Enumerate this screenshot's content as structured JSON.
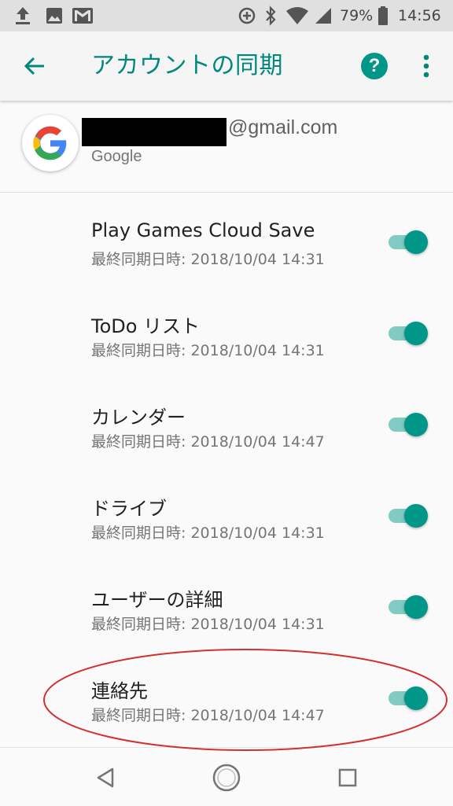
{
  "status_bar": {
    "icons": [
      "upload-icon",
      "image-icon",
      "gmail-icon",
      "data-saver-icon",
      "bluetooth-icon",
      "wifi-icon",
      "signal-icon",
      "battery-icon"
    ],
    "battery": "79%",
    "time": "14:56"
  },
  "app_bar": {
    "title": "アカウントの同期",
    "back_icon": "arrow-back-icon",
    "help_label": "?",
    "more_icon": "more-vert-icon",
    "accent_color": "#00897b"
  },
  "account": {
    "email_suffix": "@gmail.com",
    "provider": "Google",
    "avatar_icon": "google-g-icon"
  },
  "sync_items": [
    {
      "title": "Play Games Cloud Save",
      "subtitle": "最終同期日時: 2018/10/04 14:31",
      "enabled": true
    },
    {
      "title": "ToDo リスト",
      "subtitle": "最終同期日時: 2018/10/04 14:31",
      "enabled": true
    },
    {
      "title": "カレンダー",
      "subtitle": "最終同期日時: 2018/10/04 14:47",
      "enabled": true
    },
    {
      "title": "ドライブ",
      "subtitle": "最終同期日時: 2018/10/04 14:31",
      "enabled": true
    },
    {
      "title": "ユーザーの詳細",
      "subtitle": "最終同期日時: 2018/10/04 14:31",
      "enabled": true
    },
    {
      "title": "連絡先",
      "subtitle": "最終同期日時: 2018/10/04 14:47",
      "enabled": true
    }
  ],
  "toggle_colors": {
    "thumb": "#009688",
    "track": "#80cbc4"
  },
  "annotation": {
    "highlight_color": "#d32f2f",
    "highlighted_item": "連絡先"
  },
  "nav_bar": {
    "icons": [
      "back-triangle-icon",
      "home-circle-icon",
      "recents-square-icon"
    ]
  }
}
